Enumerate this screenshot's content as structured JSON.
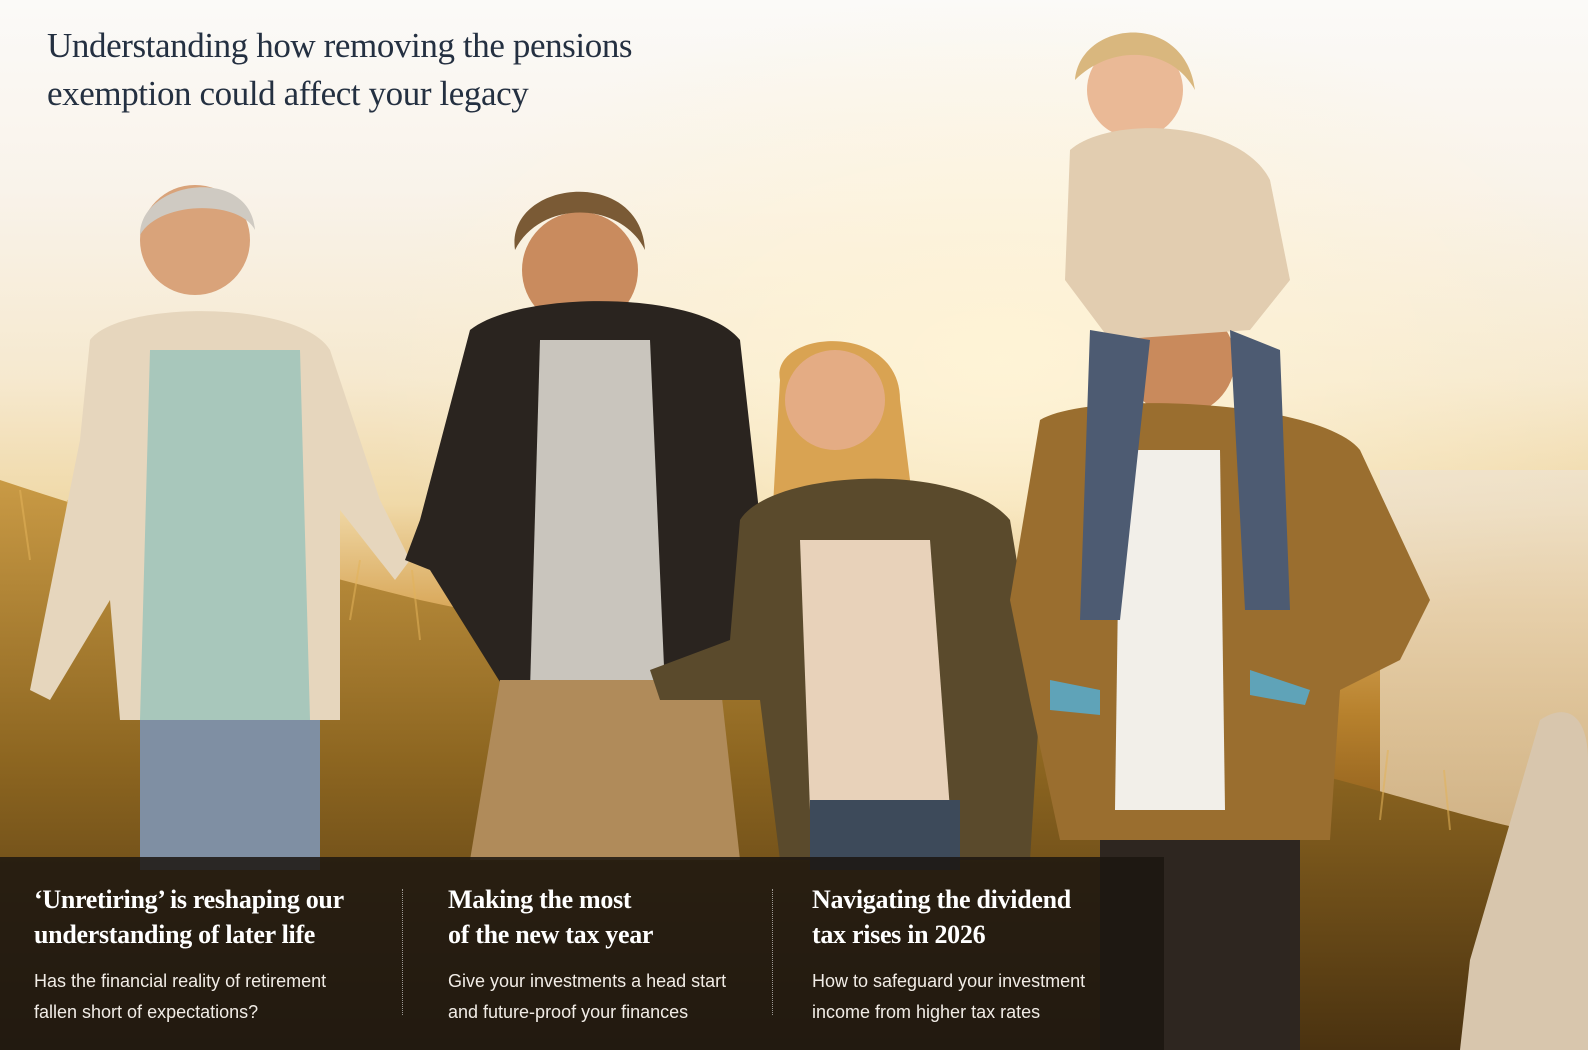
{
  "headline": {
    "line1": "Understanding how removing the pensions",
    "line2": "exemption could affect your legacy"
  },
  "cards": [
    {
      "title_line1": "‘Unretiring’ is reshaping our",
      "title_line2": "understanding of later life",
      "desc_line1": "Has the financial reality of retirement",
      "desc_line2": "fallen short of expectations?"
    },
    {
      "title_line1": "Making the most",
      "title_line2": "of the new tax year",
      "desc_line1": "Give your investments a head start",
      "desc_line2": "and future-proof your finances"
    },
    {
      "title_line1": "Navigating the dividend",
      "title_line2": "tax rises in 2026",
      "desc_line1": "How to safeguard your investment",
      "desc_line2": "income from higher tax rates"
    }
  ],
  "colors": {
    "headline": "#243041",
    "card_overlay": "#1c1610",
    "card_text": "#ffffff"
  }
}
